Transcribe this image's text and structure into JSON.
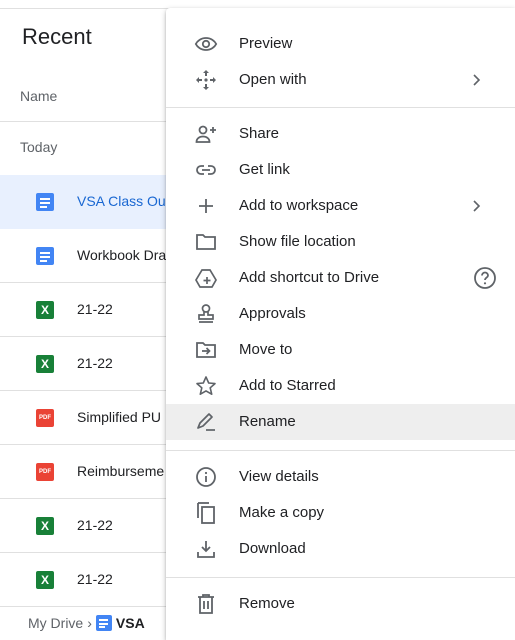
{
  "list": {
    "title": "Recent",
    "column_name": "Name",
    "group": "Today",
    "files": [
      {
        "name": "VSA Class Ou",
        "type": "doc",
        "selected": true
      },
      {
        "name": "Workbook Dra",
        "type": "doc",
        "selected": false
      },
      {
        "name": "21-22",
        "type": "xls",
        "selected": false
      },
      {
        "name": "21-22",
        "type": "xls",
        "selected": false
      },
      {
        "name": "Simplified PU",
        "type": "pdf",
        "selected": false
      },
      {
        "name": "Reimburseme",
        "type": "pdf",
        "selected": false
      },
      {
        "name": "21-22",
        "type": "xls",
        "selected": false
      },
      {
        "name": "21-22",
        "type": "xls",
        "selected": false
      }
    ],
    "icon_labels": {
      "xls": "X",
      "pdf": "PDF"
    }
  },
  "breadcrumb": {
    "root": "My Drive",
    "file": "VSA"
  },
  "menu": {
    "items": [
      {
        "label": "Preview",
        "icon": "eye-icon"
      },
      {
        "label": "Open with",
        "icon": "move-arrows-icon",
        "submenu": true
      },
      {
        "label": "Share",
        "icon": "person-add-icon"
      },
      {
        "label": "Get link",
        "icon": "link-icon"
      },
      {
        "label": "Add to workspace",
        "icon": "plus-icon",
        "submenu": true
      },
      {
        "label": "Show file location",
        "icon": "folder-icon"
      },
      {
        "label": "Add shortcut to Drive",
        "icon": "drive-shortcut-icon",
        "help": true
      },
      {
        "label": "Approvals",
        "icon": "stamp-icon"
      },
      {
        "label": "Move to",
        "icon": "move-folder-icon"
      },
      {
        "label": "Add to Starred",
        "icon": "star-outline-icon"
      },
      {
        "label": "Rename",
        "icon": "pencil-icon",
        "hovered": true
      },
      {
        "label": "View details",
        "icon": "info-icon"
      },
      {
        "label": "Make a copy",
        "icon": "copy-icon"
      },
      {
        "label": "Download",
        "icon": "download-icon"
      },
      {
        "label": "Remove",
        "icon": "trash-icon"
      }
    ]
  },
  "colors": {
    "selected_row_bg": "#e8f0fe",
    "selected_text": "#1967d2",
    "doc_blue": "#4285f4",
    "sheet_green": "#188038",
    "pdf_red": "#ea4335",
    "hover_bg": "#eeeeee"
  }
}
